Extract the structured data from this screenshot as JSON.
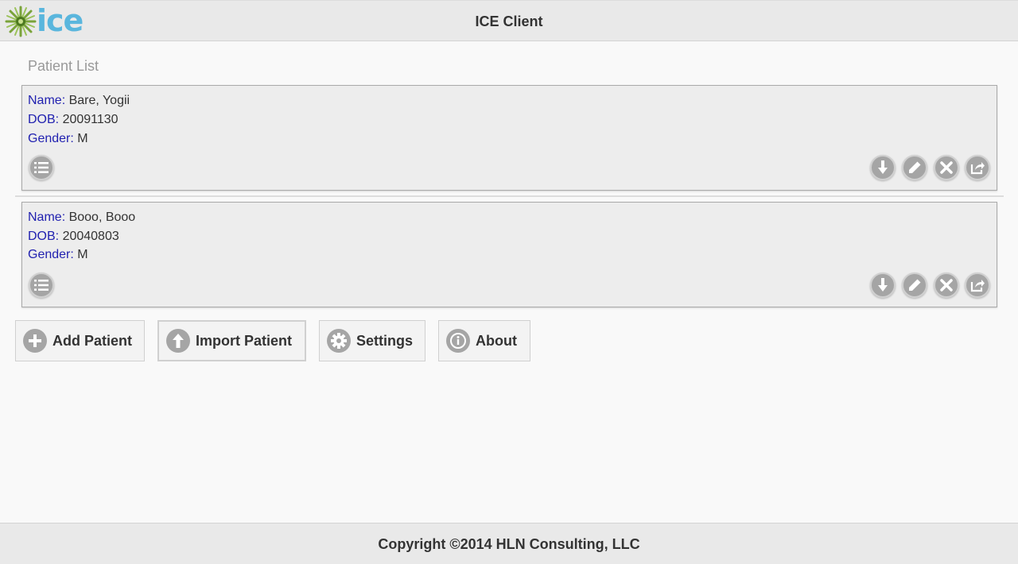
{
  "header": {
    "title": "ICE Client",
    "logo_text": "ice"
  },
  "patient_list": {
    "title": "Patient List",
    "labels": {
      "name": "Name",
      "dob": "DOB",
      "gender": "Gender"
    },
    "patients": [
      {
        "name": "Bare, Yogii",
        "dob": "20091130",
        "gender": "M"
      },
      {
        "name": "Booo, Booo",
        "dob": "20040803",
        "gender": "M"
      }
    ]
  },
  "actions": {
    "add_patient": "Add Patient",
    "import_patient": "Import Patient",
    "settings": "Settings",
    "about": "About"
  },
  "card_icons": [
    "list-icon",
    "download-icon",
    "edit-icon",
    "delete-icon",
    "export-icon"
  ],
  "colors": {
    "label_blue": "#2121b0",
    "logo_blue": "#5ab6dd",
    "icon_gray": "#a5a5a5"
  },
  "footer": {
    "copyright": "Copyright ©2014 HLN Consulting, LLC"
  }
}
